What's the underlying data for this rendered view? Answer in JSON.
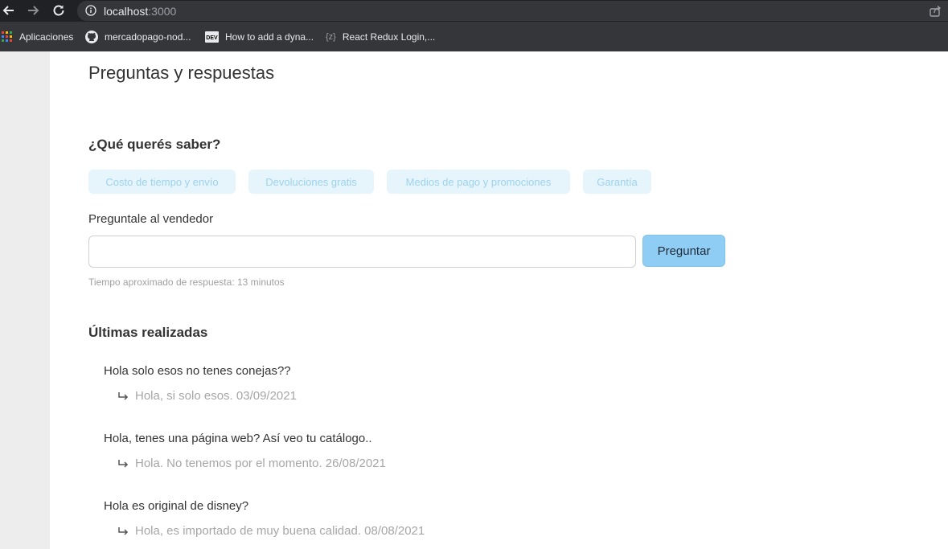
{
  "browser": {
    "url_host": "localhost",
    "url_port": ":3000",
    "bookmarks": [
      {
        "label": "Aplicaciones",
        "icon": "apps-grid-icon"
      },
      {
        "label": "mercadopago-nod...",
        "icon": "github-icon"
      },
      {
        "label": "How to add a dyna...",
        "icon": "dev-icon"
      },
      {
        "label": "React Redux Login,...",
        "icon": "braces-icon"
      }
    ]
  },
  "page": {
    "title": "Preguntas y respuestas",
    "subtitle": "¿Qué querés saber?",
    "chips": [
      "Costo de tiempo y envío",
      "Devoluciones gratis",
      "Medios de pago y promociones",
      "Garantía"
    ],
    "ask_label": "Preguntale al vendedor",
    "ask_input_value": "",
    "ask_button": "Preguntar",
    "response_time": "Tiempo aproximado de respuesta: 13 minutos",
    "latest_title": "Últimas realizadas",
    "questions": [
      {
        "q": "Hola solo esos no tenes conejas??",
        "a": "Hola, si solo esos. 03/09/2021"
      },
      {
        "q": "Hola, tenes una página web? Así veo tu catálogo..",
        "a": "Hola. No tenemos por el momento. 26/08/2021"
      },
      {
        "q": "Hola es original de disney?",
        "a": "Hola, es importado de muy buena calidad. 08/08/2021"
      }
    ]
  }
}
